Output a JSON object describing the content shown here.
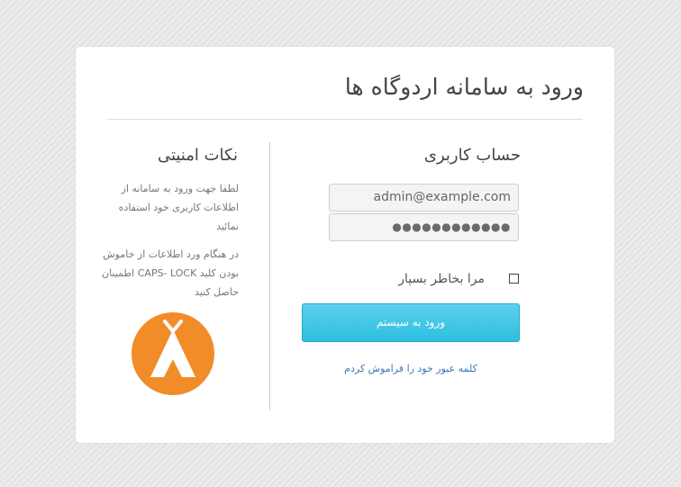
{
  "title": "ورود به سامانه اردوگاه ها",
  "login": {
    "heading": "حساب کاربری",
    "email_value": "admin@example.com",
    "password_value": "●●●●●●●●●●●●",
    "remember_label": "مرا بخاطر بسپار",
    "remember_checked": false,
    "submit_label": "ورود به سیستم",
    "forgot_link": "کلمه عبور خود را فراموش کردم"
  },
  "security": {
    "heading": "نکات امنیتی",
    "paragraph_1": "لطفا جهت ورود به سامانه از اطلاعات کاربری خود استفاده نمائید",
    "paragraph_2": "در هنگام ورد اطلاعات از خاموش بودن کلید CAPS- LOCK اطمینان حاصل کنید"
  },
  "colors": {
    "logo_circle": "#f28c28",
    "button": "#2cbfe1",
    "link": "#3a78b5"
  },
  "icons": {
    "logo": "tent-icon"
  }
}
